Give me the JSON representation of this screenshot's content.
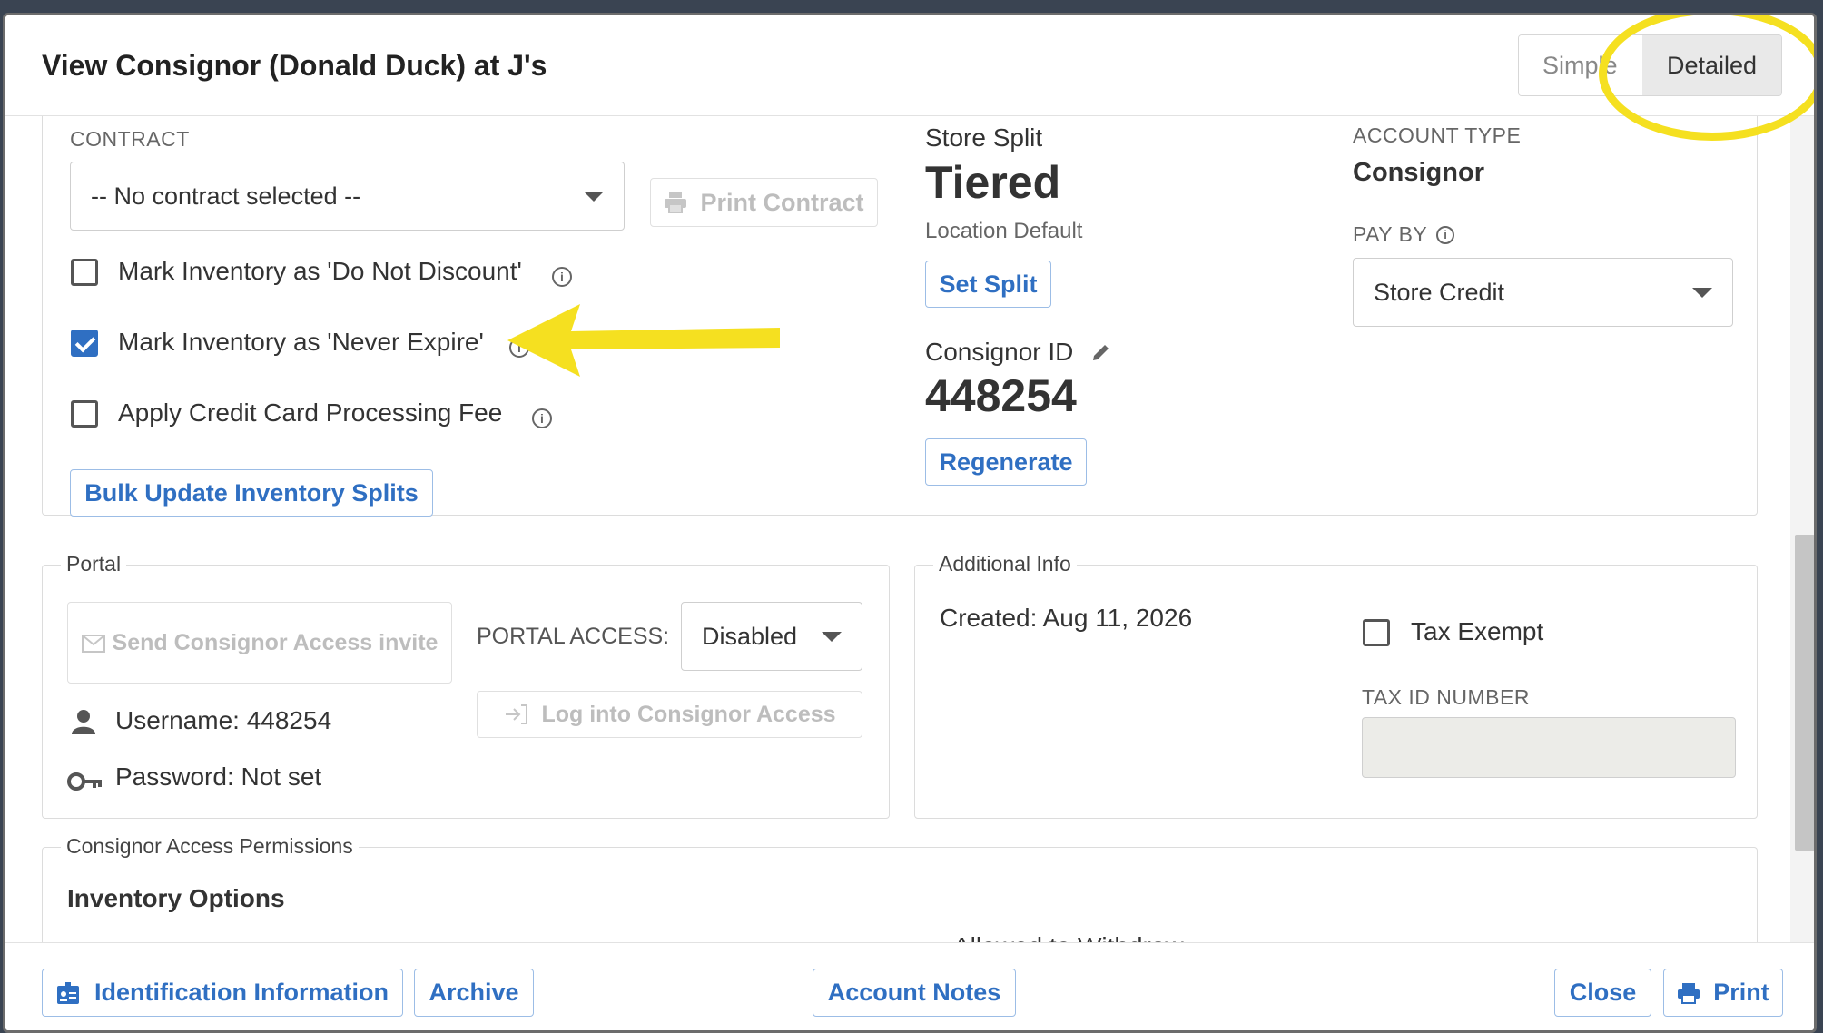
{
  "modal": {
    "title": "View Consignor (Donald Duck) at J's",
    "view_toggle": {
      "simple": "Simple",
      "detailed": "Detailed"
    }
  },
  "contract": {
    "label": "CONTRACT",
    "selected": "-- No contract selected --",
    "print_label": "Print Contract"
  },
  "checks": {
    "do_not_discount": "Mark Inventory as 'Do Not Discount'",
    "never_expire": "Mark Inventory as 'Never Expire'",
    "credit_card_fee": "Apply Credit Card Processing Fee"
  },
  "bulk_update_label": "Bulk Update Inventory Splits",
  "store_split": {
    "label": "Store Split",
    "value": "Tiered",
    "sub": "Location Default",
    "button": "Set Split"
  },
  "consignor_id": {
    "label": "Consignor ID",
    "value": "448254",
    "button": "Regenerate"
  },
  "account_type": {
    "label": "ACCOUNT TYPE",
    "value": "Consignor",
    "pay_by_label": "PAY BY",
    "pay_by_value": "Store Credit"
  },
  "portal": {
    "legend": "Portal",
    "send_invite": "Send Consignor Access invite",
    "access_label": "PORTAL ACCESS:",
    "access_value": "Disabled",
    "login_label": "Log into Consignor Access",
    "username": "Username: 448254",
    "password": "Password: Not set"
  },
  "additional_info": {
    "legend": "Additional Info",
    "created": "Created: Aug 11, 2026",
    "tax_exempt": "Tax Exempt",
    "tax_id_label": "TAX ID NUMBER",
    "tax_id_value": ""
  },
  "permissions": {
    "legend": "Consignor Access Permissions",
    "heading": "Inventory Options",
    "withdraw": "Allowed to Withdraw"
  },
  "footer": {
    "identification": "Identification Information",
    "archive": "Archive",
    "account_notes": "Account Notes",
    "close": "Close",
    "print": "Print"
  },
  "colors": {
    "accent": "#2f6fc2",
    "annotation": "#f5e020"
  }
}
